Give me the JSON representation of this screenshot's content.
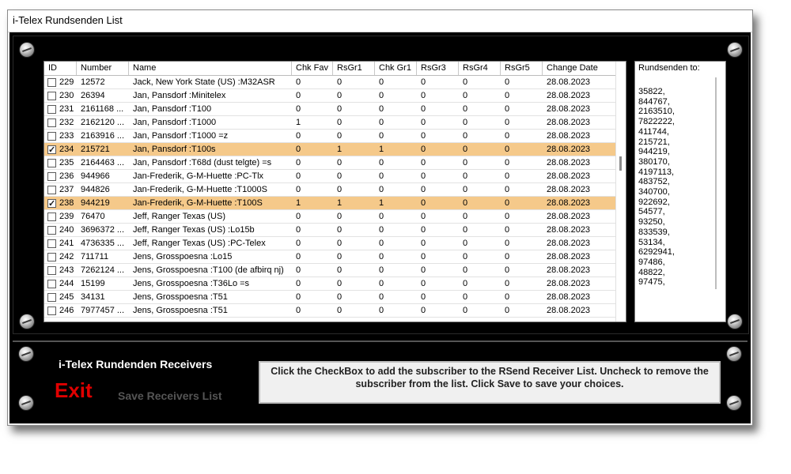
{
  "window": {
    "title": "i-Telex Rundsenden List"
  },
  "grid": {
    "columns": [
      "ID",
      "Number",
      "Name",
      "Chk Fav",
      "RsGr1",
      "Chk Gr1",
      "RsGr3",
      "RsGr4",
      "RsGr5",
      "Change Date"
    ],
    "rows": [
      {
        "checked": false,
        "id": "229",
        "number": "12572",
        "name": "Jack, New York State (US) :M32ASR",
        "chk_fav": "0",
        "rsgr1": "0",
        "chk_gr1": "0",
        "rsgr3": "0",
        "rsgr4": "0",
        "rsgr5": "0",
        "date": "28.08.2023"
      },
      {
        "checked": false,
        "id": "230",
        "number": "26394",
        "name": "Jan, Pansdorf :Minitelex",
        "chk_fav": "0",
        "rsgr1": "0",
        "chk_gr1": "0",
        "rsgr3": "0",
        "rsgr4": "0",
        "rsgr5": "0",
        "date": "28.08.2023"
      },
      {
        "checked": false,
        "id": "231",
        "number": "2161168 ...",
        "name": "Jan, Pansdorf :T100",
        "chk_fav": "0",
        "rsgr1": "0",
        "chk_gr1": "0",
        "rsgr3": "0",
        "rsgr4": "0",
        "rsgr5": "0",
        "date": "28.08.2023"
      },
      {
        "checked": false,
        "id": "232",
        "number": "2162120 ...",
        "name": "Jan, Pansdorf :T1000",
        "chk_fav": "1",
        "rsgr1": "0",
        "chk_gr1": "0",
        "rsgr3": "0",
        "rsgr4": "0",
        "rsgr5": "0",
        "date": "28.08.2023"
      },
      {
        "checked": false,
        "id": "233",
        "number": "2163916 ...",
        "name": "Jan, Pansdorf :T1000 =z",
        "chk_fav": "0",
        "rsgr1": "0",
        "chk_gr1": "0",
        "rsgr3": "0",
        "rsgr4": "0",
        "rsgr5": "0",
        "date": "28.08.2023"
      },
      {
        "checked": true,
        "id": "234",
        "number": "215721",
        "name": "Jan, Pansdorf :T100s",
        "chk_fav": "0",
        "rsgr1": "1",
        "chk_gr1": "1",
        "rsgr3": "0",
        "rsgr4": "0",
        "rsgr5": "0",
        "date": "28.08.2023"
      },
      {
        "checked": false,
        "id": "235",
        "number": "2164463 ...",
        "name": "Jan, Pansdorf :T68d (dust telgte) =s",
        "chk_fav": "0",
        "rsgr1": "0",
        "chk_gr1": "0",
        "rsgr3": "0",
        "rsgr4": "0",
        "rsgr5": "0",
        "date": "28.08.2023"
      },
      {
        "checked": false,
        "id": "236",
        "number": "944966",
        "name": "Jan-Frederik, G-M-Huette :PC-Tlx",
        "chk_fav": "0",
        "rsgr1": "0",
        "chk_gr1": "0",
        "rsgr3": "0",
        "rsgr4": "0",
        "rsgr5": "0",
        "date": "28.08.2023"
      },
      {
        "checked": false,
        "id": "237",
        "number": "944826",
        "name": "Jan-Frederik, G-M-Huette :T1000S",
        "chk_fav": "0",
        "rsgr1": "0",
        "chk_gr1": "0",
        "rsgr3": "0",
        "rsgr4": "0",
        "rsgr5": "0",
        "date": "28.08.2023"
      },
      {
        "checked": true,
        "id": "238",
        "number": "944219",
        "name": "Jan-Frederik, G-M-Huette :T100S",
        "chk_fav": "1",
        "rsgr1": "1",
        "chk_gr1": "1",
        "rsgr3": "0",
        "rsgr4": "0",
        "rsgr5": "0",
        "date": "28.08.2023"
      },
      {
        "checked": false,
        "id": "239",
        "number": "76470",
        "name": "Jeff, Ranger Texas (US)",
        "chk_fav": "0",
        "rsgr1": "0",
        "chk_gr1": "0",
        "rsgr3": "0",
        "rsgr4": "0",
        "rsgr5": "0",
        "date": "28.08.2023"
      },
      {
        "checked": false,
        "id": "240",
        "number": "3696372 ...",
        "name": "Jeff, Ranger Texas (US) :Lo15b",
        "chk_fav": "0",
        "rsgr1": "0",
        "chk_gr1": "0",
        "rsgr3": "0",
        "rsgr4": "0",
        "rsgr5": "0",
        "date": "28.08.2023"
      },
      {
        "checked": false,
        "id": "241",
        "number": "4736335 ...",
        "name": "Jeff, Ranger Texas (US) :PC-Telex",
        "chk_fav": "0",
        "rsgr1": "0",
        "chk_gr1": "0",
        "rsgr3": "0",
        "rsgr4": "0",
        "rsgr5": "0",
        "date": "28.08.2023"
      },
      {
        "checked": false,
        "id": "242",
        "number": "711711",
        "name": "Jens, Grosspoesna :Lo15",
        "chk_fav": "0",
        "rsgr1": "0",
        "chk_gr1": "0",
        "rsgr3": "0",
        "rsgr4": "0",
        "rsgr5": "0",
        "date": "28.08.2023"
      },
      {
        "checked": false,
        "id": "243",
        "number": "7262124 ...",
        "name": "Jens, Grosspoesna :T100 (de afbirq nj)",
        "chk_fav": "0",
        "rsgr1": "0",
        "chk_gr1": "0",
        "rsgr3": "0",
        "rsgr4": "0",
        "rsgr5": "0",
        "date": "28.08.2023"
      },
      {
        "checked": false,
        "id": "244",
        "number": "15199",
        "name": "Jens, Grosspoesna :T36Lo =s",
        "chk_fav": "0",
        "rsgr1": "0",
        "chk_gr1": "0",
        "rsgr3": "0",
        "rsgr4": "0",
        "rsgr5": "0",
        "date": "28.08.2023"
      },
      {
        "checked": false,
        "id": "245",
        "number": "34131",
        "name": "Jens, Grosspoesna :T51",
        "chk_fav": "0",
        "rsgr1": "0",
        "chk_gr1": "0",
        "rsgr3": "0",
        "rsgr4": "0",
        "rsgr5": "0",
        "date": "28.08.2023"
      },
      {
        "checked": false,
        "id": "246",
        "number": "7977457 ...",
        "name": "Jens, Grosspoesna :T51",
        "chk_fav": "0",
        "rsgr1": "0",
        "chk_gr1": "0",
        "rsgr3": "0",
        "rsgr4": "0",
        "rsgr5": "0",
        "date": "28.08.2023"
      }
    ]
  },
  "receivers": {
    "header": "Rundsenden to:",
    "numbers": [
      "35822,",
      "844767,",
      "2163510,",
      "7822222,",
      "411744,",
      "215721,",
      "944219,",
      "380170,",
      "4197113,",
      "483752,",
      "340700,",
      "922692,",
      "54577,",
      "93250,",
      "833539,",
      "53134,",
      "6292941,",
      "97486,",
      "48822,",
      "97475,"
    ]
  },
  "bottom": {
    "receivers_label": "i-Telex Rundenden Receivers",
    "exit_label": "Exit",
    "save_label": "Save Receivers List",
    "info_text": "Click the CheckBox to add the subscriber to the RSend Receiver List. Uncheck to remove the subscriber from the list.  Click Save to save your choices."
  },
  "colors": {
    "selected_row": "#f5c98a",
    "exit": "#e00000",
    "frame": "#000000"
  }
}
